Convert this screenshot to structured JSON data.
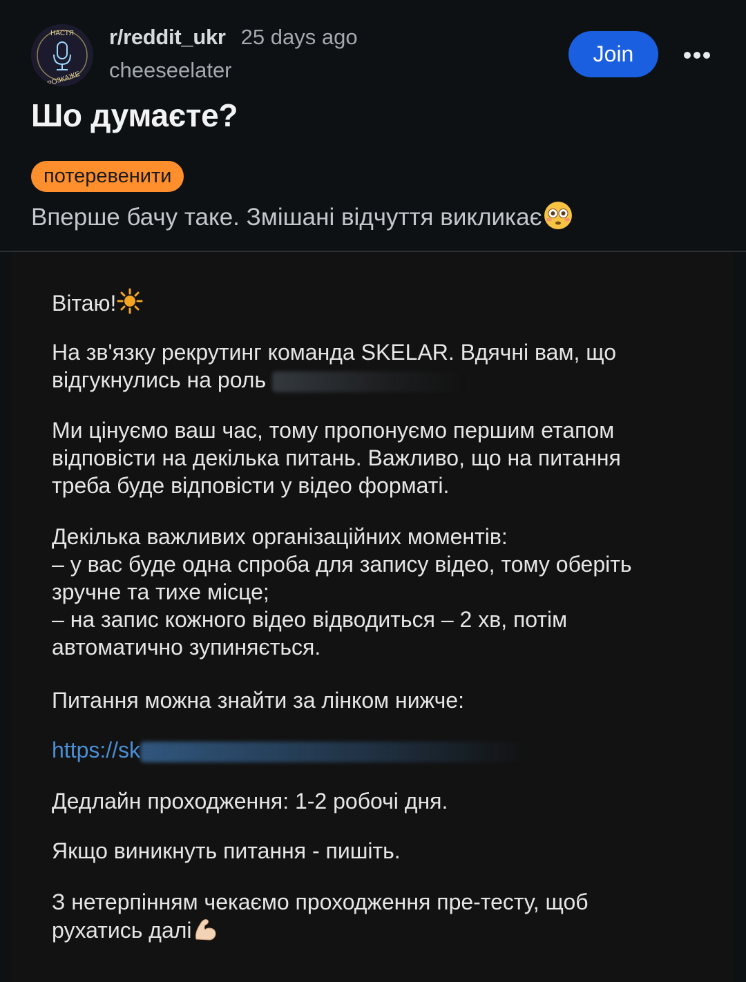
{
  "post": {
    "subreddit": "r/reddit_ukr",
    "time_ago": "25 days ago",
    "author": "cheeseelater",
    "join_label": "Join",
    "more_icon": "more-horizontal-icon",
    "title": "Шо думаєте?",
    "flair": "потеревенити",
    "body": "Вперше бачу таке. Змішані відчуття викликає",
    "body_emoji": "flushed-face-emoji"
  },
  "avatar": {
    "logo_text_top": "НАСТЯ",
    "logo_text_bottom": "РОЗКАЖЕ",
    "icon": "microphone-icon"
  },
  "message": {
    "greeting": "Вітаю!",
    "greeting_emoji": "sun-emoji",
    "p1_line1": "На зв'язку рекрутинг команда SKELAR. Вдячні вам, що",
    "p1_line2": "відгукнулись на роль",
    "p2_line1": "Ми цінуємо ваш час, тому пропонуємо першим етапом",
    "p2_line2": "відповісти на декілька питань. Важливо, що на питання",
    "p2_line3": "треба буде відповісти у відео форматі.",
    "p3_line1": "Декілька важливих організаційних моментів:",
    "p3_line2": "– у вас буде одна спроба для запису відео, тому оберіть",
    "p3_line3": "зручне та тихе місце;",
    "p3_line4": "– на запис кожного відео відводиться – 2 хв, потім",
    "p3_line5": "автоматично зупиняється.",
    "p4": "Питання можна знайти за лінком нижче:",
    "link_visible": "https://sk",
    "p5": "Дедлайн проходження: 1-2 робочі дня.",
    "p6": "Якщо виникнуть питання - пишіть.",
    "p7_line1": "З нетерпінням чекаємо проходження пре-тесту, щоб",
    "p7_line2": "рухатись далі",
    "closing_emoji": "flexed-biceps-emoji"
  },
  "colors": {
    "background": "#0e1113",
    "join_button": "#1a5fe0",
    "flair": "#ff8f2d",
    "link": "#4a8fd6"
  }
}
